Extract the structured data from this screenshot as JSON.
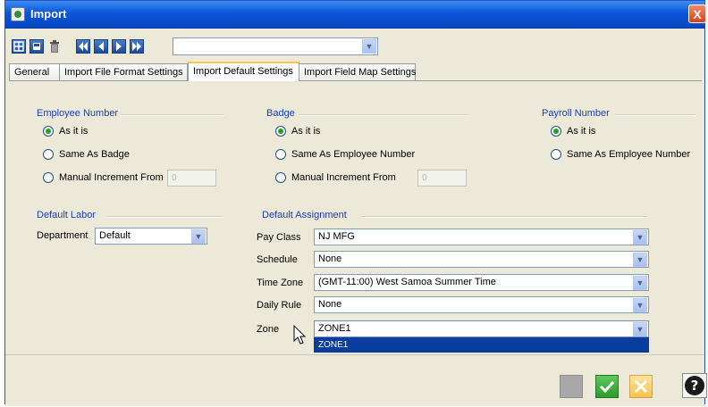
{
  "window": {
    "title": "Import",
    "close_label": "X"
  },
  "toolbar": {
    "buttons": [
      "add-icon",
      "save-icon",
      "trash-icon",
      "first-record-icon",
      "previous-record-icon",
      "next-record-icon",
      "last-record-icon"
    ],
    "record_selector_value": ""
  },
  "tabs": [
    {
      "label": "General"
    },
    {
      "label": "Import File Format Settings"
    },
    {
      "label": "Import Default Settings",
      "active": true
    },
    {
      "label": "Import Field Map Settings"
    }
  ],
  "employee_number": {
    "title": "Employee Number",
    "options": [
      "As it is",
      "Same As Badge",
      "Manual Increment From"
    ],
    "selected": "As it is",
    "increment_value": "0"
  },
  "badge": {
    "title": "Badge",
    "options": [
      "As it is",
      "Same As Employee Number",
      "Manual Increment From"
    ],
    "selected": "As it is",
    "increment_value": "0"
  },
  "payroll_number": {
    "title": "Payroll Number",
    "options": [
      "As it is",
      "Same As Employee Number"
    ],
    "selected": "As it is"
  },
  "default_labor": {
    "title": "Default Labor",
    "department_label": "Department",
    "department_value": "Default"
  },
  "default_assignment": {
    "title": "Default Assignment",
    "pay_class_label": "Pay Class",
    "pay_class_value": "NJ MFG",
    "schedule_label": "Schedule",
    "schedule_value": "None",
    "time_zone_label": "Time Zone",
    "time_zone_value": "(GMT-11:00) West Samoa Summer Time",
    "daily_rule_label": "Daily Rule",
    "daily_rule_value": "None",
    "zone_label": "Zone",
    "zone_value": "ZONE1",
    "zone_options": [
      "ZONE1"
    ]
  },
  "colors": {
    "title_bar": "#0a55d8",
    "group_title": "#1a3fb8",
    "dropdown_highlight": "#0a3e9e",
    "ok_button": "#2b9b2b",
    "cancel_button": "#f7c24a"
  }
}
